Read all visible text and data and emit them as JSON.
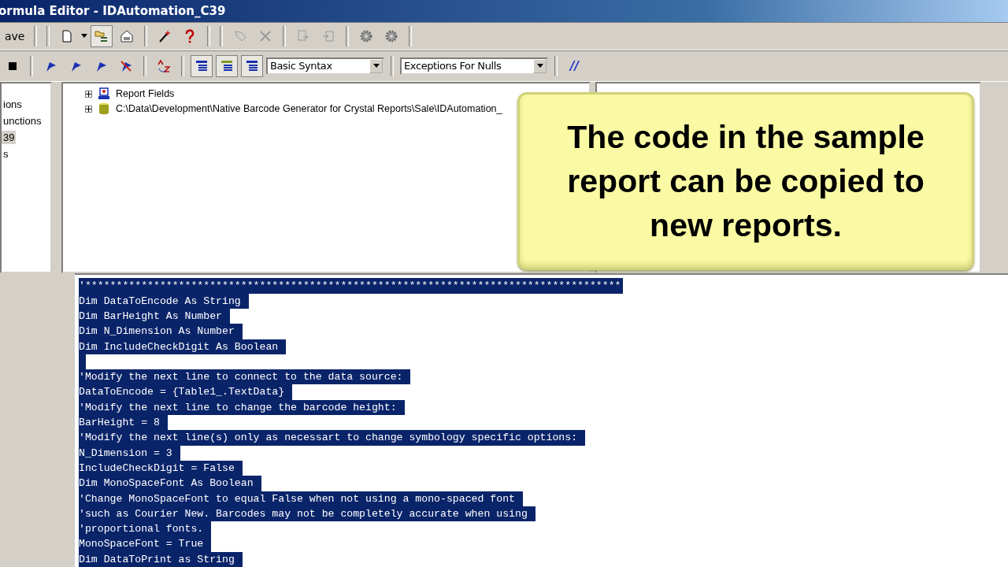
{
  "window": {
    "title": "ormula Editor - IDAutomation_C39"
  },
  "toolbar": {
    "save_label": "ave",
    "syntax": "Basic Syntax",
    "nulls": "Exceptions For Nulls",
    "comment_label": "//",
    "pressed_view": true
  },
  "workshop_tree": {
    "items": [
      {
        "label": "ions",
        "selected": false
      },
      {
        "label": "unctions",
        "selected": false
      },
      {
        "label": "39",
        "selected": true
      },
      {
        "label": "s",
        "selected": false
      }
    ]
  },
  "field_tree": {
    "items": [
      {
        "label": "Report Fields",
        "kind": "fields",
        "expanded": false
      },
      {
        "label": "C:\\Data\\Development\\Native Barcode Generator for Crystal Reports\\Sale\\IDAutomation_",
        "kind": "database",
        "expanded": false
      }
    ]
  },
  "callout": {
    "text": "The code in the sample report can be copied to new reports."
  },
  "editor": {
    "selected": true,
    "lines": [
      {
        "kind": "code",
        "text": "'**************************************************************************************"
      },
      {
        "kind": "code",
        "text": "Dim DataToEncode As String "
      },
      {
        "kind": "code",
        "text": "Dim BarHeight As Number "
      },
      {
        "kind": "code",
        "text": "Dim N_Dimension As Number "
      },
      {
        "kind": "code",
        "text": "Dim IncludeCheckDigit As Boolean "
      },
      {
        "kind": "blank"
      },
      {
        "kind": "code",
        "text": "'Modify the next line to connect to the data source: "
      },
      {
        "kind": "code",
        "text": "DataToEncode = {Table1_.TextData} "
      },
      {
        "kind": "code",
        "text": "'Modify the next line to change the barcode height: "
      },
      {
        "kind": "code",
        "text": "BarHeight = 8 "
      },
      {
        "kind": "code",
        "text": "'Modify the next line(s) only as necessart to change symbology specific options: "
      },
      {
        "kind": "code",
        "text": "N_Dimension = 3 "
      },
      {
        "kind": "code",
        "text": "IncludeCheckDigit = False "
      },
      {
        "kind": "code",
        "text": "Dim MonoSpaceFont As Boolean "
      },
      {
        "kind": "code",
        "text": "'Change MonoSpaceFont to equal False when not using a mono-spaced font "
      },
      {
        "kind": "code",
        "text": "'such as Courier New. Barcodes may not be completely accurate when using "
      },
      {
        "kind": "code",
        "text": "'proportional fonts. "
      },
      {
        "kind": "code",
        "text": "MonoSpaceFont = True "
      },
      {
        "kind": "code",
        "text": "Dim DataToPrint as String "
      }
    ]
  }
}
